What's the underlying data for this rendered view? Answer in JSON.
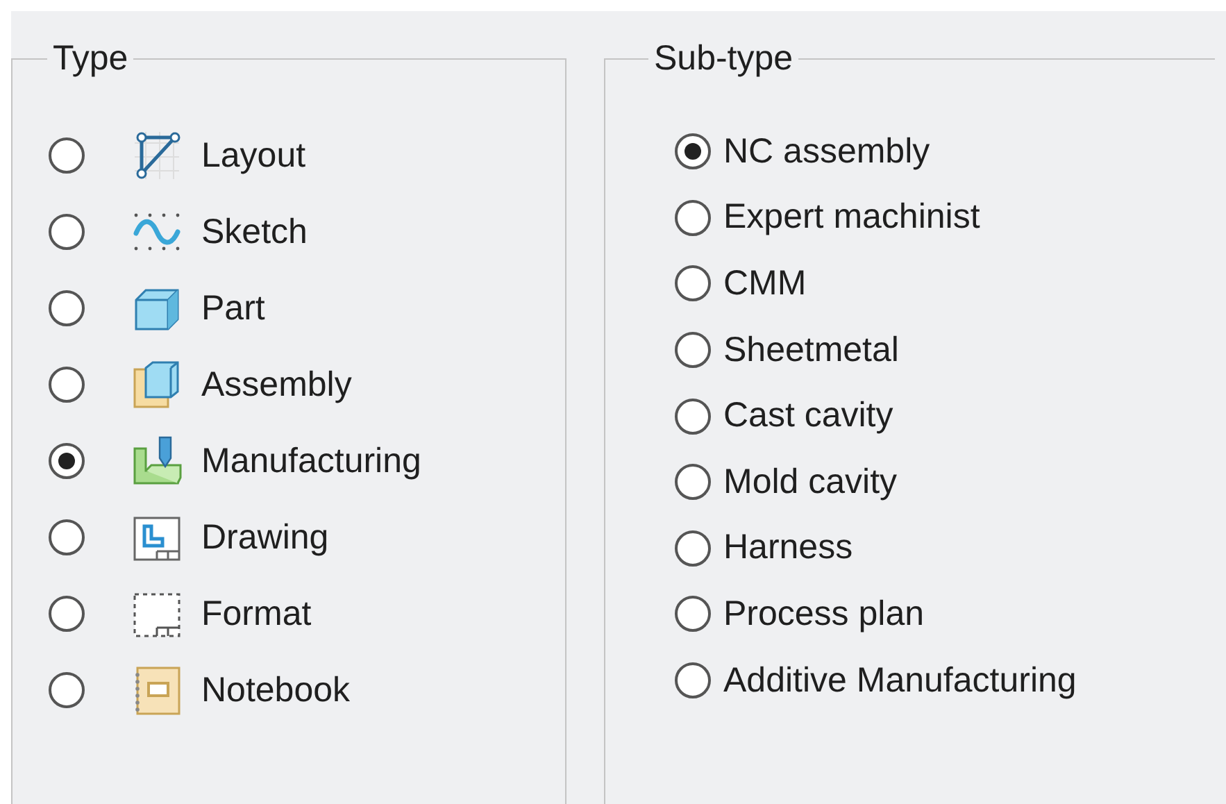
{
  "type_group": {
    "title": "Type",
    "options": [
      {
        "label": "Layout",
        "selected": false
      },
      {
        "label": "Sketch",
        "selected": false
      },
      {
        "label": "Part",
        "selected": false
      },
      {
        "label": "Assembly",
        "selected": false
      },
      {
        "label": "Manufacturing",
        "selected": true
      },
      {
        "label": "Drawing",
        "selected": false
      },
      {
        "label": "Format",
        "selected": false
      },
      {
        "label": "Notebook",
        "selected": false
      }
    ]
  },
  "subtype_group": {
    "title": "Sub-type",
    "options": [
      {
        "label": "NC assembly",
        "selected": true
      },
      {
        "label": "Expert machinist",
        "selected": false
      },
      {
        "label": "CMM",
        "selected": false
      },
      {
        "label": "Sheetmetal",
        "selected": false
      },
      {
        "label": "Cast cavity",
        "selected": false
      },
      {
        "label": "Mold cavity",
        "selected": false
      },
      {
        "label": "Harness",
        "selected": false
      },
      {
        "label": "Process plan",
        "selected": false
      },
      {
        "label": "Additive Manufacturing",
        "selected": false
      }
    ]
  }
}
